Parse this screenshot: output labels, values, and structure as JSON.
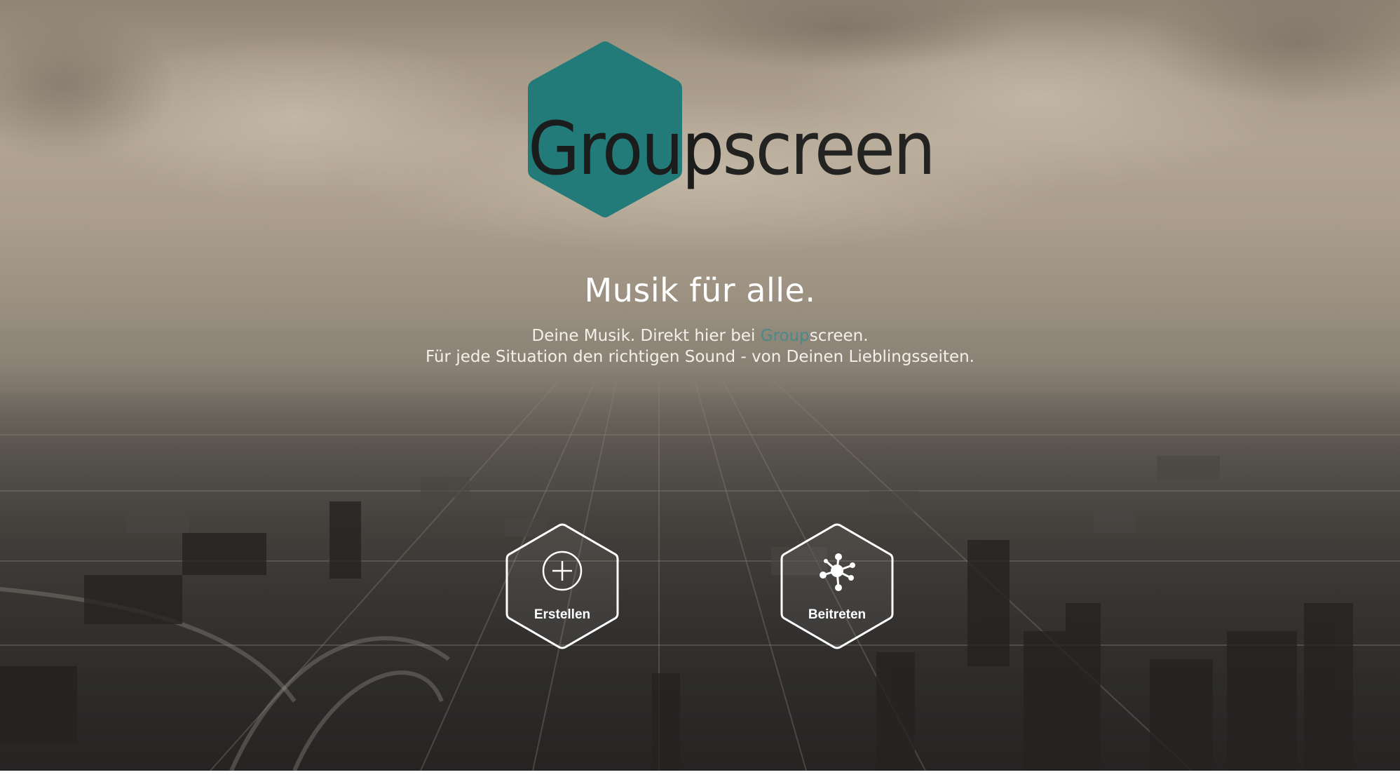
{
  "brand": {
    "name_part1": "Group",
    "name_part2": "screen",
    "accent_color": "#227a79"
  },
  "hero": {
    "headline": "Musik für alle.",
    "line1_prefix": "Deine Musik. Direkt hier bei ",
    "line1_brand_part1": "Group",
    "line1_brand_part2": "screen.",
    "line2": "Für jede Situation den richtigen Sound - von Deinen Lieblingsseiten."
  },
  "actions": {
    "create_label": "Erstellen",
    "create_icon": "plus-circle-icon",
    "join_label": "Beitreten",
    "join_icon": "network-hub-icon"
  }
}
